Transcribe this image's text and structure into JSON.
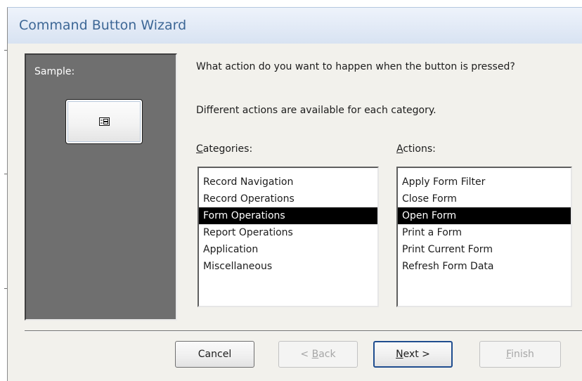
{
  "window": {
    "title": "Command Button Wizard"
  },
  "sample": {
    "label": "Sample:",
    "button_icon": "form-icon"
  },
  "prompt": {
    "question": "What action do you want to happen when the button is pressed?",
    "hint": "Different actions are available for each category."
  },
  "categories": {
    "label_mnemonic": "C",
    "label_rest": "ategories:",
    "items": [
      {
        "label": "Record Navigation"
      },
      {
        "label": "Record Operations"
      },
      {
        "label": "Form Operations"
      },
      {
        "label": "Report Operations"
      },
      {
        "label": "Application"
      },
      {
        "label": "Miscellaneous"
      }
    ],
    "selected": "Form Operations"
  },
  "actions": {
    "label_mnemonic": "A",
    "label_rest": "ctions:",
    "items": [
      {
        "label": "Apply Form Filter"
      },
      {
        "label": "Close Form"
      },
      {
        "label": "Open Form"
      },
      {
        "label": "Print a Form"
      },
      {
        "label": "Print Current Form"
      },
      {
        "label": "Refresh Form Data"
      }
    ],
    "selected": "Open Form"
  },
  "buttons": {
    "cancel": {
      "label": "Cancel",
      "enabled": true
    },
    "back": {
      "pre": "< ",
      "mnemonic": "B",
      "rest": "ack",
      "enabled": false
    },
    "next": {
      "mnemonic": "N",
      "rest": "ext >",
      "enabled": true
    },
    "finish": {
      "mnemonic": "F",
      "rest": "inish",
      "enabled": false
    }
  },
  "colors": {
    "title_text": "#3d6796",
    "selection_bg": "#000000",
    "selection_text": "#ffffff",
    "sample_panel": "#6f6f6f"
  }
}
